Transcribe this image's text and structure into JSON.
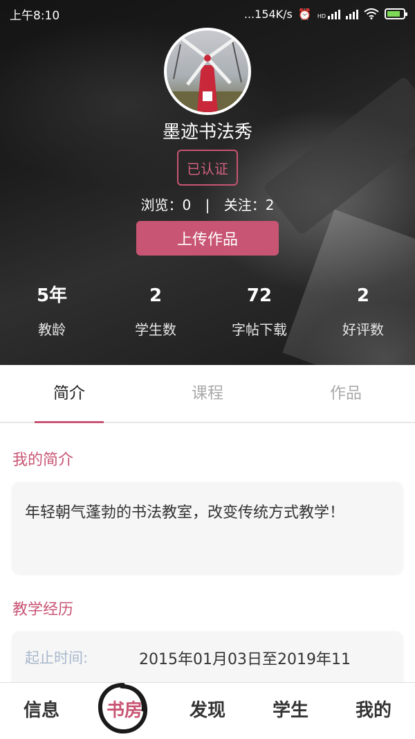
{
  "status_bar": {
    "time": "上午8:10",
    "network_speed": "...154K/s",
    "hd": "HD",
    "battery_color": "#7ed957"
  },
  "profile": {
    "name": "墨迹书法秀",
    "verified_label": "已认证",
    "views_label": "浏览：0",
    "separator": "|",
    "follows_label": "关注：2",
    "upload_button": "上传作品"
  },
  "metrics": [
    {
      "value": "5年",
      "label": "教龄"
    },
    {
      "value": "2",
      "label": "学生数"
    },
    {
      "value": "72",
      "label": "字帖下载"
    },
    {
      "value": "2",
      "label": "好评数"
    }
  ],
  "tabs": [
    {
      "label": "简介",
      "active": true
    },
    {
      "label": "课程",
      "active": false
    },
    {
      "label": "作品",
      "active": false
    }
  ],
  "intro": {
    "title": "我的简介",
    "text": "年轻朝气蓬勃的书法教室，改变传统方式教学！"
  },
  "experience": {
    "title": "教学经历",
    "period_label": "起止时间:",
    "period_value": "2015年01月03日至2019年11"
  },
  "bottom_nav": [
    {
      "label": "信息",
      "active": false
    },
    {
      "label": "书房",
      "active": true
    },
    {
      "label": "发现",
      "active": false
    },
    {
      "label": "学生",
      "active": false
    },
    {
      "label": "我的",
      "active": false
    }
  ],
  "colors": {
    "accent": "#c85573",
    "label_muted": "#a8b8cc"
  }
}
